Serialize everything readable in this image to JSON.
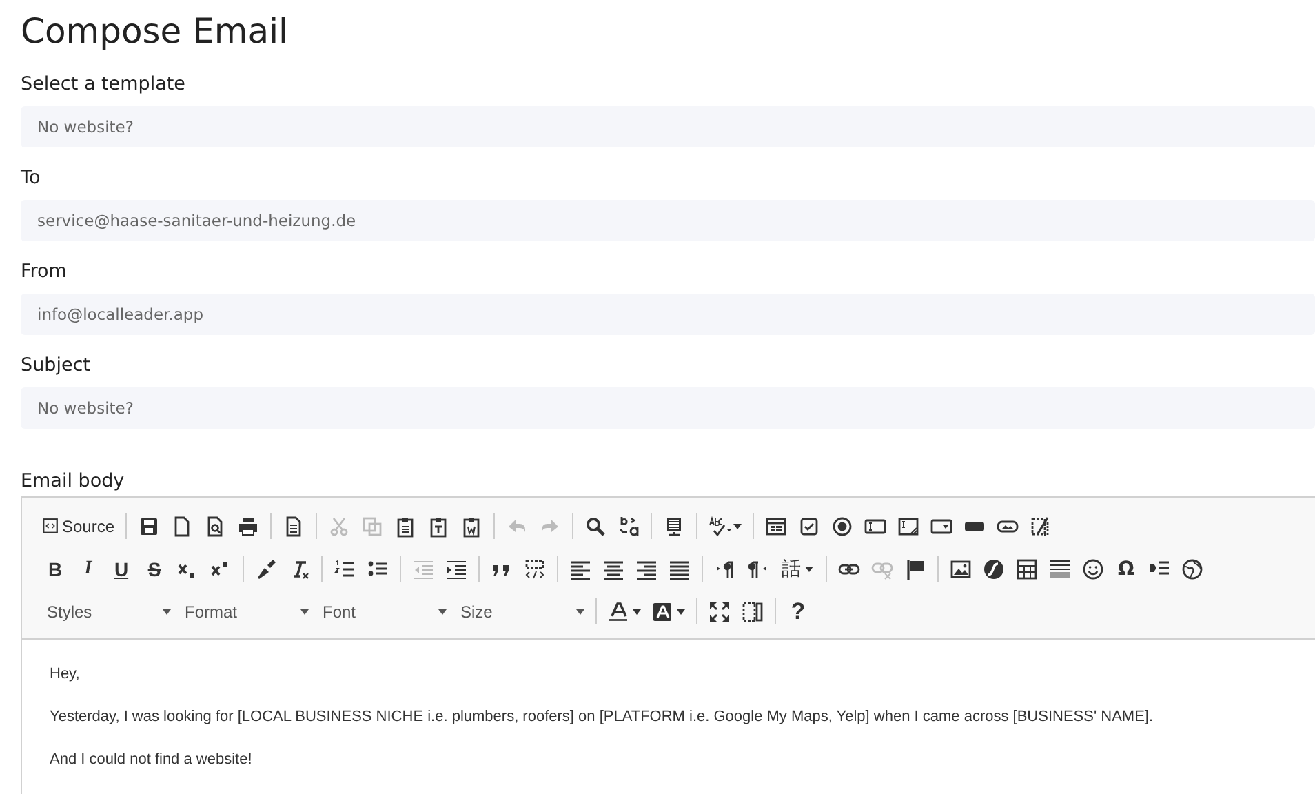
{
  "title": "Compose Email",
  "fields": [
    {
      "label": "Select a template",
      "value": "No website?"
    },
    {
      "label": "To",
      "value": "service@haase-sanitaer-und-heizung.de"
    },
    {
      "label": "From",
      "value": "info@localleader.app"
    },
    {
      "label": "Subject",
      "value": "No website?"
    }
  ],
  "editor": {
    "label": "Email body",
    "toolbar": [
      [
        [
          {
            "kind": "source",
            "label": "Source",
            "disabled": false
          }
        ],
        [
          {
            "kind": "save",
            "disabled": false
          },
          {
            "kind": "newpage",
            "disabled": false
          },
          {
            "kind": "preview",
            "disabled": false
          },
          {
            "kind": "print",
            "disabled": false
          }
        ],
        [
          {
            "kind": "templates",
            "disabled": false
          }
        ],
        [
          {
            "kind": "cut",
            "disabled": true
          },
          {
            "kind": "copy",
            "disabled": true
          },
          {
            "kind": "paste",
            "disabled": false
          },
          {
            "kind": "pastetext",
            "disabled": false
          },
          {
            "kind": "pasteword",
            "disabled": false
          }
        ],
        [
          {
            "kind": "undo",
            "disabled": true
          },
          {
            "kind": "redo",
            "disabled": true
          }
        ],
        [
          {
            "kind": "find",
            "disabled": false
          },
          {
            "kind": "replace",
            "disabled": false
          }
        ],
        [
          {
            "kind": "selectall",
            "disabled": false
          }
        ],
        [
          {
            "kind": "spellcheck",
            "disabled": false
          }
        ],
        [
          {
            "kind": "form",
            "disabled": false
          },
          {
            "kind": "checkbox",
            "disabled": false
          },
          {
            "kind": "radio",
            "disabled": false
          },
          {
            "kind": "textfield",
            "disabled": false
          },
          {
            "kind": "textarea",
            "disabled": false
          },
          {
            "kind": "select",
            "disabled": false
          },
          {
            "kind": "formbutton",
            "disabled": false
          },
          {
            "kind": "imagebutton",
            "disabled": false
          },
          {
            "kind": "hiddenfield",
            "disabled": false
          }
        ]
      ],
      [
        [
          {
            "kind": "bold",
            "label": "B",
            "disabled": false
          },
          {
            "kind": "italic",
            "label": "I",
            "disabled": false
          },
          {
            "kind": "underline",
            "label": "U",
            "disabled": false
          },
          {
            "kind": "strike",
            "label": "S",
            "disabled": false
          },
          {
            "kind": "subscript",
            "disabled": false
          },
          {
            "kind": "superscript",
            "disabled": false
          }
        ],
        [
          {
            "kind": "copyformat",
            "disabled": false
          },
          {
            "kind": "removeformat",
            "disabled": false
          }
        ],
        [
          {
            "kind": "numberedlist",
            "disabled": false
          },
          {
            "kind": "bulletedlist",
            "disabled": false
          }
        ],
        [
          {
            "kind": "outdent",
            "disabled": true
          },
          {
            "kind": "indent",
            "disabled": false
          }
        ],
        [
          {
            "kind": "blockquote",
            "disabled": false
          },
          {
            "kind": "creatediv",
            "disabled": false
          }
        ],
        [
          {
            "kind": "alignleft",
            "disabled": false
          },
          {
            "kind": "aligncenter",
            "disabled": false
          },
          {
            "kind": "alignright",
            "disabled": false
          },
          {
            "kind": "justify",
            "disabled": false
          }
        ],
        [
          {
            "kind": "ltr",
            "disabled": false
          },
          {
            "kind": "rtl",
            "disabled": false
          },
          {
            "kind": "language",
            "label": "話",
            "disabled": false
          }
        ],
        [
          {
            "kind": "link",
            "disabled": false
          },
          {
            "kind": "unlink",
            "disabled": true
          },
          {
            "kind": "anchor",
            "disabled": false
          }
        ],
        [
          {
            "kind": "image",
            "disabled": false
          },
          {
            "kind": "flash",
            "disabled": false
          },
          {
            "kind": "table",
            "disabled": false
          },
          {
            "kind": "hr",
            "disabled": false
          },
          {
            "kind": "smiley",
            "disabled": false
          },
          {
            "kind": "specialchar",
            "label": "Ω",
            "disabled": false
          },
          {
            "kind": "pagebreak",
            "disabled": false
          },
          {
            "kind": "iframe",
            "disabled": false
          }
        ]
      ],
      [
        [
          {
            "kind": "combo",
            "label": "Styles",
            "disabled": false
          },
          {
            "kind": "combo",
            "label": "Format",
            "disabled": false
          },
          {
            "kind": "combo",
            "label": "Font",
            "disabled": false
          },
          {
            "kind": "combo",
            "label": "Size",
            "disabled": false
          }
        ],
        [
          {
            "kind": "textcolor",
            "disabled": false
          },
          {
            "kind": "bgcolor",
            "disabled": false
          }
        ],
        [
          {
            "kind": "maximize",
            "disabled": false
          },
          {
            "kind": "showblocks",
            "disabled": false
          }
        ],
        [
          {
            "kind": "help",
            "label": "?",
            "disabled": false
          }
        ]
      ]
    ],
    "paragraphs": [
      "Hey,",
      "Yesterday, I was looking for [LOCAL BUSINESS NICHE i.e. plumbers, roofers] on [PLATFORM i.e. Google My Maps, Yelp] when I came across [BUSINESS' NAME].",
      "And I could not find a website!"
    ]
  }
}
